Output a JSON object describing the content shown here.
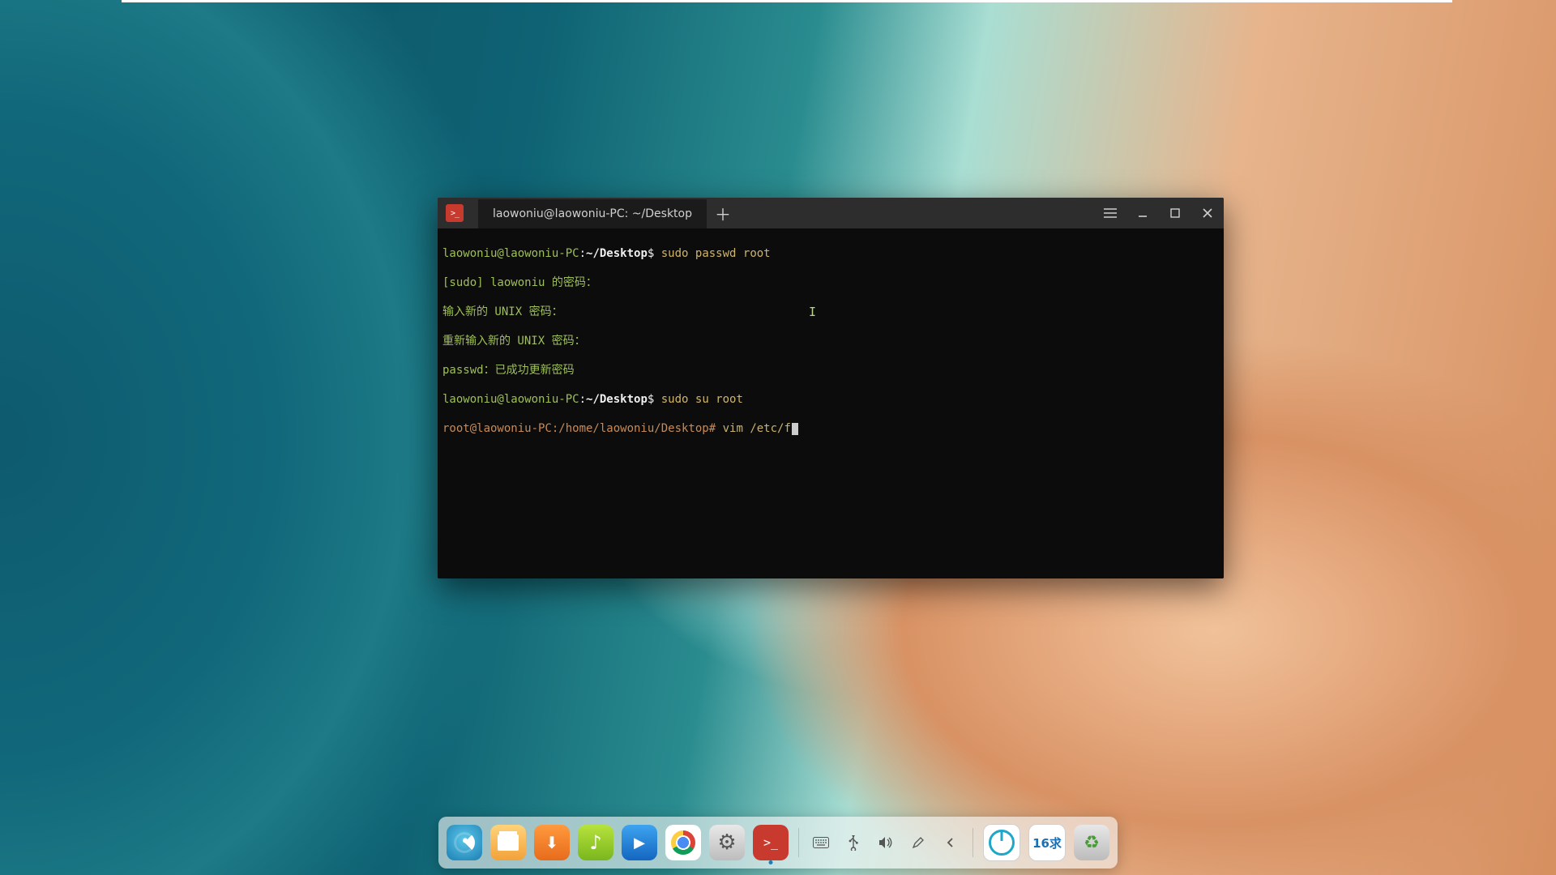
{
  "window": {
    "tab_title": "laowoniu@laowoniu-PC: ~/Desktop",
    "app_icon": "terminal-icon",
    "controls": {
      "menu": "menu-icon",
      "minimize": "minimize-icon",
      "maximize": "maximize-icon",
      "close": "close-icon"
    }
  },
  "terminal": {
    "lines": [
      {
        "prompt_user": "laowoniu@laowoniu-PC",
        "colon": ":",
        "path": "~/Desktop",
        "dollar": "$",
        "command": " sudo passwd root"
      },
      {
        "out": "[sudo] laowoniu 的密码："
      },
      {
        "out": "输入新的 UNIX 密码："
      },
      {
        "out": "重新输入新的 UNIX 密码："
      },
      {
        "out": "passwd：已成功更新密码"
      },
      {
        "prompt_user": "laowoniu@laowoniu-PC",
        "colon": ":",
        "path": "~/Desktop",
        "dollar": "$",
        "command": " sudo su root"
      },
      {
        "root_prompt": "root@laowoniu-PC:/home/laowoniu/Desktop",
        "hash": "#",
        "command": " vim /etc/f"
      }
    ]
  },
  "dock": {
    "apps": [
      {
        "name": "launcher",
        "label": "Launcher"
      },
      {
        "name": "files",
        "label": "File Manager"
      },
      {
        "name": "appstore",
        "label": "App Store"
      },
      {
        "name": "music",
        "label": "Music"
      },
      {
        "name": "video",
        "label": "Video"
      },
      {
        "name": "chrome",
        "label": "Google Chrome"
      },
      {
        "name": "settings",
        "label": "Control Center"
      },
      {
        "name": "terminal",
        "label": "Terminal",
        "running": true
      }
    ],
    "tray": [
      {
        "name": "keyboard-icon"
      },
      {
        "name": "usb-icon"
      },
      {
        "name": "volume-icon"
      },
      {
        "name": "edit-icon"
      },
      {
        "name": "back-icon"
      }
    ],
    "power": {
      "name": "power-button"
    },
    "ime": {
      "label": "16求"
    },
    "trash": {
      "name": "trash"
    }
  }
}
